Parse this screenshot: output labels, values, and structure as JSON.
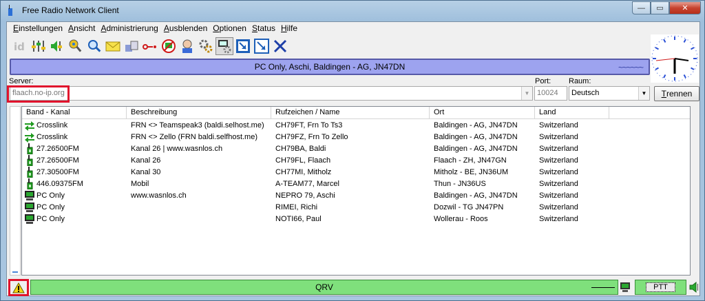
{
  "window": {
    "title": "Free Radio Network Client",
    "minimize": "—",
    "maximize": "▭",
    "close": "✕"
  },
  "menu": [
    {
      "key": "E",
      "rest": "instellungen"
    },
    {
      "key": "A",
      "rest": "nsicht"
    },
    {
      "key": "A",
      "rest": "dministrierung"
    },
    {
      "key": "A",
      "rest": "usblenden"
    },
    {
      "key": "O",
      "rest": "ptionen"
    },
    {
      "key": "S",
      "rest": "tatus"
    },
    {
      "key": "H",
      "rest": "ilfe"
    }
  ],
  "toolbar_icons": [
    "id-icon",
    "mixer-icon",
    "speaker-volume-icon",
    "key-icon",
    "magnifier-icon",
    "envelope-icon",
    "hand-icon",
    "connector-icon",
    "no-pc-icon",
    "user-icon",
    "gears-icon",
    "pc-settings-icon",
    "window-restore-icon",
    "window-shrink-icon",
    "close-x-icon"
  ],
  "banner": {
    "text": "PC Only, Aschi, Baldingen - AG, JN47DN",
    "wave": "~~~~~~"
  },
  "server": {
    "label": "Server:",
    "value": "flaach.no-ip.org",
    "port_label": "Port:",
    "port_value": "10024",
    "room_label": "Raum:",
    "room_value": "Deutsch",
    "disconnect_label": "Trennen",
    "disconnect_key": "T",
    "disconnect_rest": "rennen"
  },
  "table": {
    "columns": [
      "Band - Kanal",
      "Beschreibung",
      "Rufzeichen / Name",
      "Ort",
      "Land"
    ],
    "rows": [
      {
        "icon": "crosslink",
        "band": "Crosslink",
        "desc": "FRN <> Teamspeak3 (baldi.selhost.me)",
        "call": "CH79FT, Frn To Ts3",
        "ort": "Baldingen - AG, JN47DN",
        "land": "Switzerland"
      },
      {
        "icon": "crosslink",
        "band": "Crosslink",
        "desc": "FRN <> Zello (FRN baldi.selfhost.me)",
        "call": "CH79FZ, Frn To Zello",
        "ort": "Baldingen - AG, JN47DN",
        "land": "Switzerland"
      },
      {
        "icon": "radio",
        "band": "27.26500FM",
        "desc": "Kanal 26 | www.wasnlos.ch",
        "call": "CH79BA, Baldi",
        "ort": "Baldingen - AG, JN47DN",
        "land": "Switzerland"
      },
      {
        "icon": "radio",
        "band": "27.26500FM",
        "desc": "Kanal 26",
        "call": "CH79FL, Flaach",
        "ort": "Flaach - ZH, JN47GN",
        "land": "Switzerland"
      },
      {
        "icon": "radio",
        "band": "27.30500FM",
        "desc": "Kanal 30",
        "call": "CH77MI, Mitholz",
        "ort": "Mitholz - BE, JN36UM",
        "land": "Switzerland"
      },
      {
        "icon": "radio",
        "band": "446.09375FM",
        "desc": "Mobil",
        "call": "A-TEAM77, Marcel",
        "ort": "Thun - JN36US",
        "land": "Switzerland"
      },
      {
        "icon": "pc",
        "band": "PC Only",
        "desc": "www.wasnlos.ch",
        "call": "NEPRO 79, Aschi",
        "ort": "Baldingen - AG, JN47DN",
        "land": "Switzerland"
      },
      {
        "icon": "pc",
        "band": "PC Only",
        "desc": "",
        "call": "RIMEI, Richi",
        "ort": "Dozwil - TG JN47PN",
        "land": "Switzerland"
      },
      {
        "icon": "pc",
        "band": "PC Only",
        "desc": "",
        "call": "NOTI66, Paul",
        "ort": "Wollerau - Roos",
        "land": "Switzerland"
      }
    ]
  },
  "statusbar": {
    "qrv": "QRV",
    "ptt": "PTT"
  },
  "colors": {
    "banner": "#9da3ef",
    "qrv": "#7fe07c",
    "highlight": "#e0122c"
  }
}
